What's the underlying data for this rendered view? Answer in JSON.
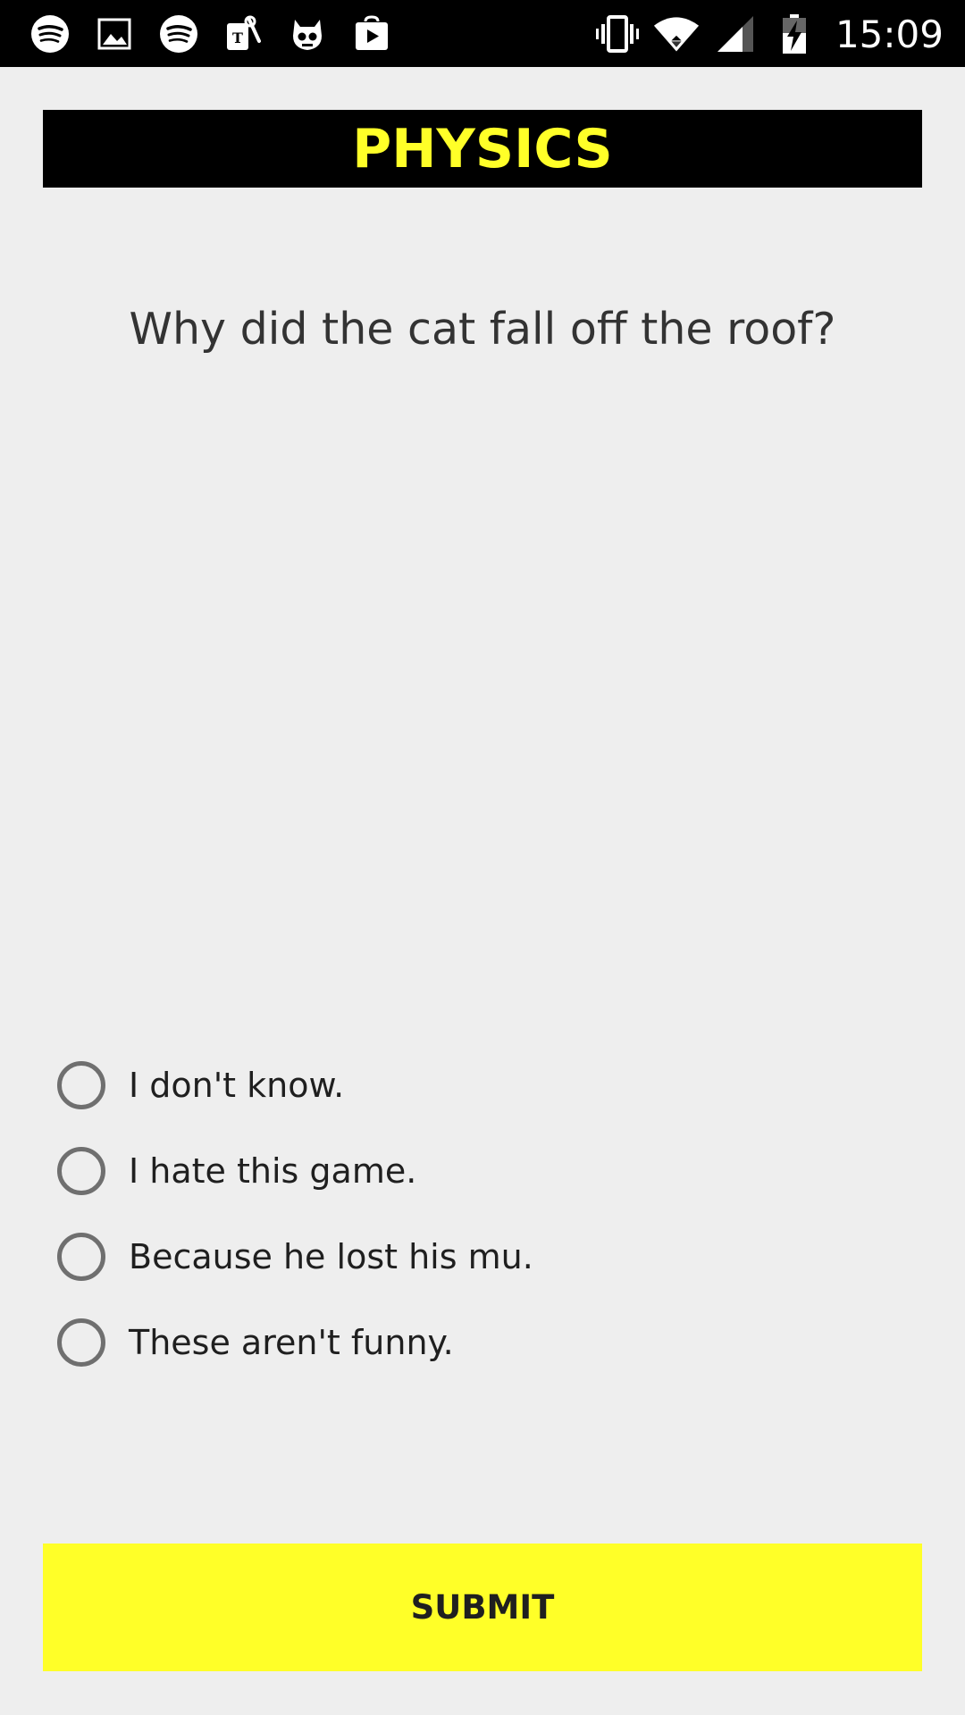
{
  "status_bar": {
    "time": "15:09",
    "left_icons": [
      "spotify-icon",
      "gallery-icon",
      "spotify-icon",
      "tmobile-icon",
      "cyanogen-icon",
      "play-store-icon"
    ],
    "right_icons": [
      "vibrate-icon",
      "wifi-icon",
      "signal-icon",
      "battery-icon"
    ]
  },
  "header": {
    "title": "PHYSICS"
  },
  "question": {
    "text": "Why did the cat fall off the roof?"
  },
  "options": [
    {
      "label": "I don't know."
    },
    {
      "label": "I hate this game."
    },
    {
      "label": "Because he lost his mu."
    },
    {
      "label": "These aren't funny."
    }
  ],
  "submit": {
    "label": "SUBMIT"
  },
  "colors": {
    "accent": "#ffff28",
    "background": "#eeeeee",
    "bar": "#000000",
    "radio_outline": "#6f6f6f"
  }
}
